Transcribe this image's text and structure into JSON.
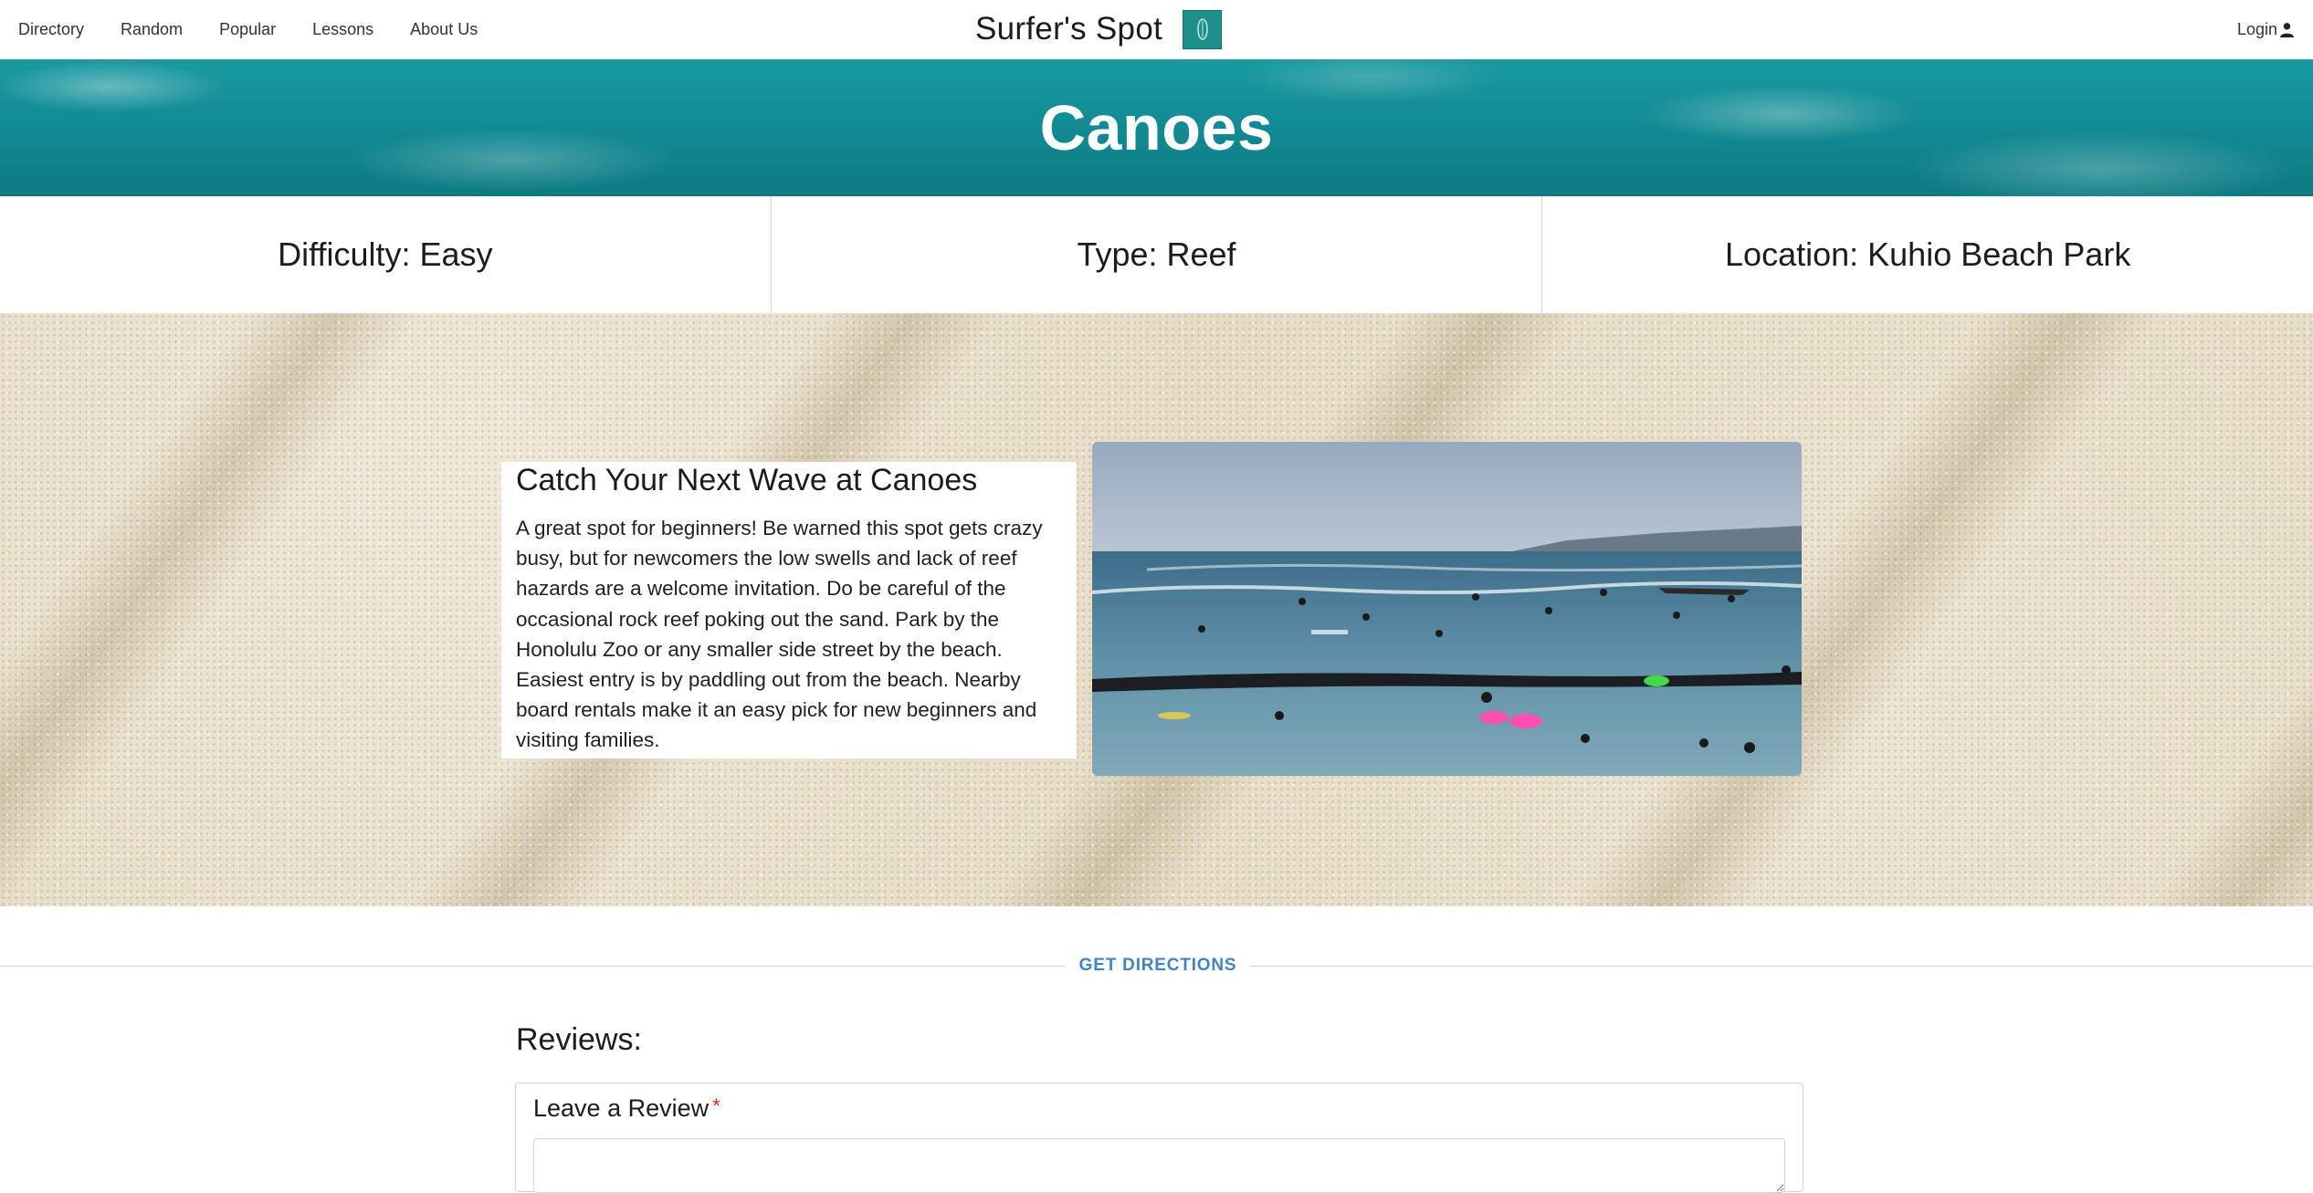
{
  "nav": {
    "links": [
      "Directory",
      "Random",
      "Popular",
      "Lessons",
      "About Us"
    ],
    "brand": "Surfer's Spot",
    "login_label": "Login"
  },
  "hero": {
    "title": "Canoes"
  },
  "info": {
    "difficulty": "Difficulty: Easy",
    "type": "Type: Reef",
    "location": "Location: Kuhio Beach Park"
  },
  "spot": {
    "heading": "Catch Your Next Wave at Canoes",
    "description": "A great spot for beginners! Be warned this spot gets crazy busy, but for newcomers the low swells and lack of reef hazards are a welcome invitation. Do be careful of the occasional rock reef poking out the sand. Park by the Honolulu Zoo or any smaller side street by the beach. Easiest entry is by paddling out from the beach. Nearby board rentals make it an easy pick for new beginners and visiting families."
  },
  "directions": {
    "label": "GET DIRECTIONS"
  },
  "reviews": {
    "heading": "Reviews:",
    "leave_label": "Leave a Review",
    "required_mark": "*",
    "input_value": ""
  },
  "colors": {
    "accent_link": "#4183c4",
    "hero_teal": "#118a93",
    "logo_teal": "#1f8f8c",
    "required_red": "#db2828"
  },
  "icons": [
    "surfboard-logo-icon",
    "user-icon"
  ]
}
